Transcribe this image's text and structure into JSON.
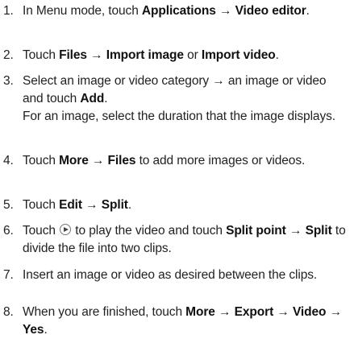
{
  "steps": [
    {
      "num": "1.",
      "a": "In Menu mode, touch ",
      "b": "Applications",
      "c": " → ",
      "d": "Video editor",
      "e": "."
    },
    {
      "num": "2.",
      "a": "Touch ",
      "b": "Files",
      "c": " → ",
      "d": "Import image",
      "e": " or ",
      "f": "Import video",
      "g": "."
    },
    {
      "num": "3.",
      "a": "Select an image or video category → an image or video and touch ",
      "b": "Add",
      "c": ".",
      "sub": "For an image, select the duration that the image displays."
    },
    {
      "num": "4.",
      "a": "Touch ",
      "b": "More",
      "c": " → ",
      "d": "Files",
      "e": " to add more images or videos."
    },
    {
      "num": "5.",
      "a": "Touch ",
      "b": "Edit",
      "c": " → ",
      "d": "Split",
      "e": "."
    },
    {
      "num": "6.",
      "a": "Touch ",
      "c": " to play the video and touch ",
      "d": "Split point",
      "e": " → ",
      "f": "Split",
      "g": " to divide the file into two clips."
    },
    {
      "num": "7.",
      "a": "Insert an image or video as desired between the clips."
    },
    {
      "num": "8.",
      "a": "When you are finished, touch ",
      "b": "More",
      "c": " → ",
      "d": "Export",
      "e": " → ",
      "f": "Video",
      "g": " → ",
      "h": "Yes",
      "i": "."
    }
  ],
  "icons": {
    "play": "play-icon"
  }
}
